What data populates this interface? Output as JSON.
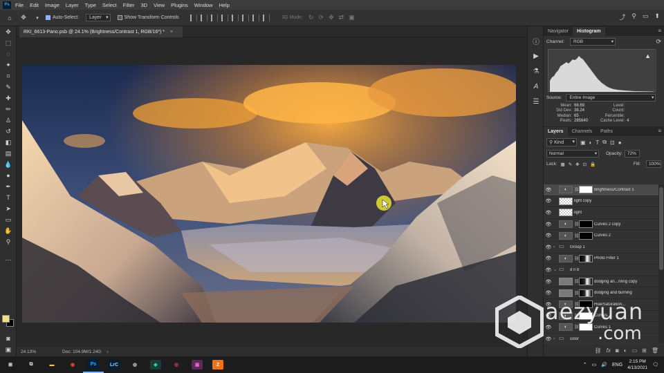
{
  "menu": {
    "app_logo": "Ps",
    "items": [
      "File",
      "Edit",
      "Image",
      "Layer",
      "Type",
      "Select",
      "Filter",
      "3D",
      "View",
      "Plugins",
      "Window",
      "Help"
    ]
  },
  "options": {
    "auto_select_label": "Auto-Select:",
    "auto_select_checked": true,
    "auto_select_target": "Layer",
    "show_transform_label": "Show Transform Controls",
    "mode_3d_label": "3D Mode:"
  },
  "document": {
    "tab_title": "RKI_6613-Pano.psb @ 24.1% (Brightness/Contrast 1, RGB/16*) *",
    "close_glyph": "×"
  },
  "status": {
    "zoom": "24.13%",
    "doc_info": "Doc: 104.9M/1.24G",
    "arrow": "›"
  },
  "histogram": {
    "tabs": [
      "Navigator",
      "Histogram"
    ],
    "active_tab": "Histogram",
    "channel_label": "Channel:",
    "channel_value": "RGB",
    "source_label": "Source:",
    "source_value": "Entire Image",
    "stats_left": [
      {
        "k": "Mean:",
        "v": "68.69"
      },
      {
        "k": "Std Dev:",
        "v": "38.24"
      },
      {
        "k": "Median:",
        "v": "65"
      },
      {
        "k": "Pixels:",
        "v": "285640"
      }
    ],
    "stats_right": [
      {
        "k": "Level:",
        "v": ""
      },
      {
        "k": "Count:",
        "v": ""
      },
      {
        "k": "Percentile:",
        "v": ""
      },
      {
        "k": "Cache Level:",
        "v": "4"
      }
    ]
  },
  "layers_panel": {
    "tabs": [
      "Layers",
      "Channels",
      "Paths"
    ],
    "active_tab": "Layers",
    "kind_label": "Kind",
    "blend_mode": "Normal",
    "opacity_label": "Opacity:",
    "opacity_value": "72%",
    "lock_label": "Lock:",
    "fill_label": "Fill:",
    "fill_value": "100%",
    "layers": [
      {
        "name": "Brightness/Contrast 1",
        "thumb": "adj",
        "mask": "white",
        "selected": true,
        "expander": ""
      },
      {
        "name": "light copy",
        "thumb": "checker",
        "mask": "",
        "selected": false,
        "expander": ""
      },
      {
        "name": "light",
        "thumb": "checker",
        "mask": "",
        "selected": false,
        "expander": ""
      },
      {
        "name": "Curves 2 copy",
        "thumb": "adj",
        "mask": "black",
        "selected": false,
        "expander": ""
      },
      {
        "name": "Curves 2",
        "thumb": "adj",
        "mask": "black",
        "selected": false,
        "expander": ""
      },
      {
        "name": "Group 1",
        "thumb": "folder",
        "mask": "",
        "selected": false,
        "expander": "›"
      },
      {
        "name": "Photo Filter 1",
        "thumb": "adj",
        "mask": "mixed",
        "selected": false,
        "expander": ""
      },
      {
        "name": "d n b",
        "thumb": "folder",
        "mask": "",
        "selected": false,
        "expander": "⌄"
      },
      {
        "name": "dodging an...rning copy",
        "thumb": "gray",
        "mask": "mixed",
        "selected": false,
        "expander": ""
      },
      {
        "name": "dodging and burning",
        "thumb": "gray",
        "mask": "mixed",
        "selected": false,
        "expander": ""
      },
      {
        "name": "Hue/Saturation...",
        "thumb": "adj",
        "mask": "black",
        "selected": false,
        "expander": ""
      },
      {
        "name": "Curves...",
        "thumb": "adj",
        "mask": "white",
        "selected": false,
        "expander": ""
      },
      {
        "name": "Curves 1",
        "thumb": "adj",
        "mask": "white",
        "selected": false,
        "expander": ""
      },
      {
        "name": "color",
        "thumb": "folder",
        "mask": "",
        "selected": false,
        "expander": "›"
      }
    ]
  },
  "watermark": {
    "line1": "aezyuan",
    "line2": ".com"
  },
  "taskbar": {
    "apps": [
      {
        "name": "start-icon",
        "glyph": "⊞",
        "color": "#ffffff",
        "bg": "transparent"
      },
      {
        "name": "task-view-icon",
        "glyph": "⧉",
        "color": "#dddddd",
        "bg": "transparent"
      },
      {
        "name": "file-explorer-icon",
        "glyph": "▬",
        "color": "#f7c948",
        "bg": "transparent"
      },
      {
        "name": "chrome-icon",
        "glyph": "◉",
        "color": "#e8453c",
        "bg": "transparent"
      },
      {
        "name": "photoshop-icon",
        "glyph": "Ps",
        "color": "#31a8ff",
        "bg": "#001e36"
      },
      {
        "name": "lightroom-classic-icon",
        "glyph": "LrC",
        "color": "#add5ec",
        "bg": "#001e36"
      },
      {
        "name": "globe-app-icon",
        "glyph": "◍",
        "color": "#bbbbbb",
        "bg": "transparent"
      },
      {
        "name": "capture-app-icon",
        "glyph": "◆",
        "color": "#2ad4a0",
        "bg": "#1d3b3b"
      },
      {
        "name": "recorder-app-icon",
        "glyph": "◎",
        "color": "#ff4b4b",
        "bg": "transparent"
      },
      {
        "name": "media-app-icon",
        "glyph": "▣",
        "color": "#e06bd1",
        "bg": "#5b2a5a"
      },
      {
        "name": "sketch-app-icon",
        "glyph": "Z",
        "color": "#ffffff",
        "bg": "#e8741d"
      }
    ],
    "language": "ENG",
    "time": "2:15 PM",
    "date": "4/13/2021"
  },
  "colors": {
    "foreground": "#f3dc8c",
    "background": "#000000",
    "accent": "#31a8ff"
  }
}
